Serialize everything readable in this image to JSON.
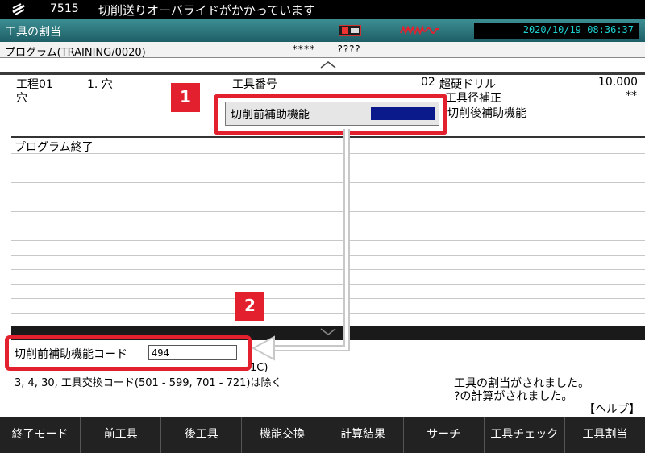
{
  "alarm": {
    "code": "7515",
    "message": "切削送りオーバライドがかかっています"
  },
  "mode": {
    "title": "工具の割当",
    "datetime": "2020/10/19 08:36:37"
  },
  "program": {
    "name": "プログラム(TRAINING/0020)",
    "s1": "****",
    "s2": "????"
  },
  "header": {
    "process": "工程01",
    "process_num": "1. 穴",
    "process_sub": "穴",
    "tool_no_label": "工具番号",
    "tool_no": "02",
    "tool_name": "超硬ドリル",
    "diameter": "10.000",
    "tool_comp_label": "工具径補正",
    "tool_comp": "**",
    "after_label": "切削後補助機能"
  },
  "popup1": {
    "label": "切削前補助機能",
    "badge": "1"
  },
  "list": {
    "item": "プログラム終了"
  },
  "input": {
    "label": "切削前補助機能コード",
    "value": "494",
    "badge": "2"
  },
  "help": {
    "line1": "3, 4, 30, 工具交換コード(501 - 599, 701 - 721)は除く",
    "partial": "1C)",
    "msg1": "工具の割当がされました。",
    "msg2": "?の計算がされました。",
    "help_label": "【ヘルプ】"
  },
  "softkeys": [
    "終了モード",
    "前工具",
    "後工具",
    "機能交換",
    "計算結果",
    "サーチ",
    "工具チェック",
    "工具割当"
  ]
}
